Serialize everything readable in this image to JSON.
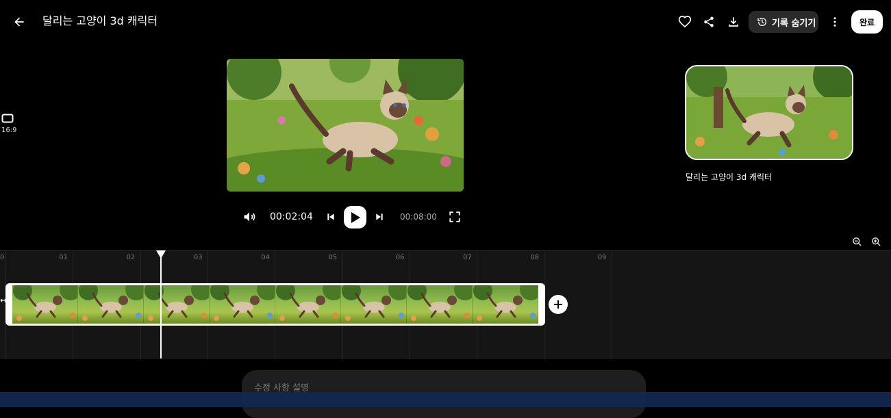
{
  "header": {
    "title": "달리는 고양이 3d 캐릭터",
    "history_label": "기록 숨기기",
    "done_label": "완료"
  },
  "aspect": {
    "label": "16:9"
  },
  "preview": {
    "title": "달리는 고양이 3d 캐릭터"
  },
  "player": {
    "current_time": "00:02:04",
    "total_time": "00:08:00"
  },
  "timeline": {
    "ticks": [
      "0",
      "01",
      "02",
      "03",
      "04",
      "05",
      "06",
      "07",
      "08",
      "09"
    ],
    "playhead_seconds": 2.31,
    "clip_frames": 8
  },
  "edit": {
    "placeholder": "수정 사항 설명"
  },
  "colors": {
    "background": "#000000",
    "timeline_bg": "#151515",
    "accent": "#ffffff"
  }
}
